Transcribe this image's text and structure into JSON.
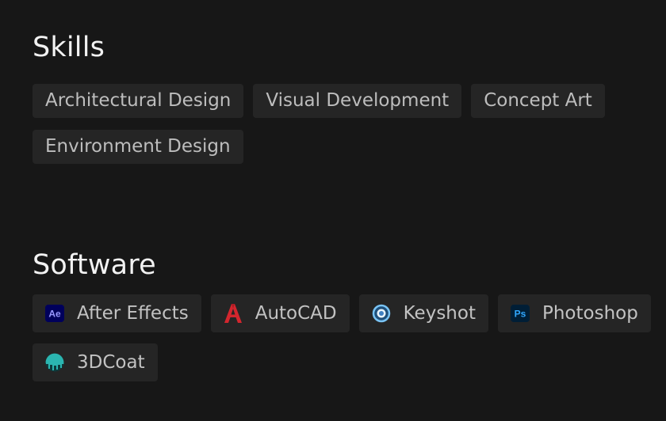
{
  "skills": {
    "title": "Skills",
    "items": [
      {
        "label": "Architectural Design"
      },
      {
        "label": "Visual Development"
      },
      {
        "label": "Concept Art"
      },
      {
        "label": "Environment Design"
      }
    ]
  },
  "software": {
    "title": "Software",
    "items": [
      {
        "label": "After Effects",
        "icon": "after-effects-icon",
        "icon_text": "Ae",
        "color": "#9999ff"
      },
      {
        "label": "AutoCAD",
        "icon": "autocad-icon",
        "color": "#d3262e"
      },
      {
        "label": "Keyshot",
        "icon": "keyshot-icon",
        "color": "#4fa3e3"
      },
      {
        "label": "Photoshop",
        "icon": "photoshop-icon",
        "icon_text": "Ps",
        "color": "#31a8ff"
      },
      {
        "label": "3DCoat",
        "icon": "3dcoat-icon",
        "color": "#2bb5b0"
      }
    ]
  },
  "colors": {
    "background": "#171717",
    "tag_background": "#252525",
    "title_text": "#f2f2f2",
    "tag_text": "#bdbdbd"
  }
}
